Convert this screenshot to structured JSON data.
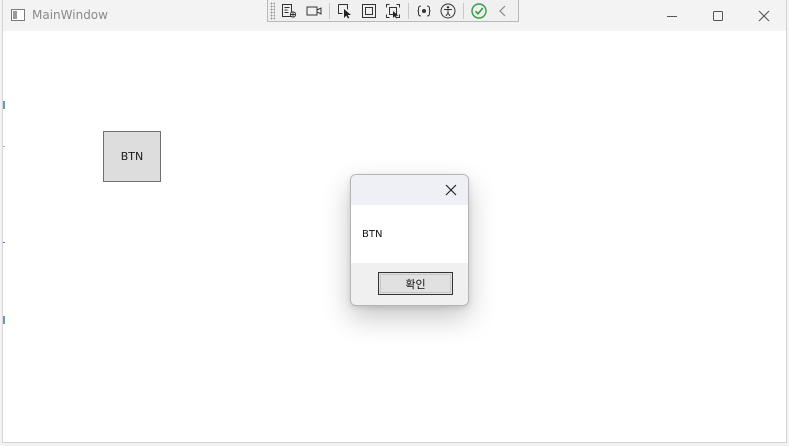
{
  "window": {
    "title": "MainWindow"
  },
  "dev_toolbar": {
    "tools": [
      {
        "name": "visual-tree-icon"
      },
      {
        "name": "record-icon"
      },
      {
        "name": "select-element-icon"
      },
      {
        "name": "display-adorners-icon"
      },
      {
        "name": "track-focus-icon"
      },
      {
        "name": "binding-failures-icon"
      },
      {
        "name": "accessibility-icon"
      },
      {
        "name": "check-icon"
      },
      {
        "name": "collapse-chevron-icon"
      }
    ]
  },
  "main": {
    "button_label": "BTN"
  },
  "message_box": {
    "text": "BTN",
    "ok_label": "확인"
  }
}
